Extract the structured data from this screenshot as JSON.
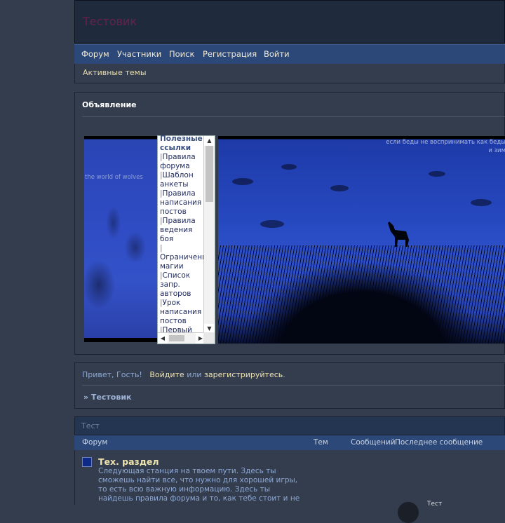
{
  "site": {
    "title": "Тестовик"
  },
  "nav": {
    "items": [
      "Форум",
      "Участники",
      "Поиск",
      "Регистрация",
      "Войти"
    ]
  },
  "subnav": {
    "active_topics": "Активные темы"
  },
  "announcement": {
    "title": "Объявление",
    "left_caption": "the world of wolves",
    "quote_line1": "если беды не воспринимать как беды",
    "quote_line2": "и зим",
    "links_heading": "Полезные ссылки",
    "links": [
      "Правила форума",
      "Шаблон анкеты",
      "Правила написания постов",
      "Правила ведения боя",
      "Ограничения магии",
      "Список запр. авторов",
      "Урок написания постов",
      "Первый"
    ],
    "link_bar": "|"
  },
  "greeting": {
    "hello": "Привет, Гость!",
    "login": "Войдите",
    "or": "или",
    "register": "зарегистрируйтесь",
    "period": ".",
    "breadcrumb": "» Тестовик"
  },
  "category": {
    "title": "Тест",
    "columns": {
      "forum": "Форум",
      "topics": "Тем",
      "posts": "Сообщений",
      "last": "Последнее сообщение"
    },
    "forums": [
      {
        "name": "Тех. раздел",
        "description": "Следующая станция на твоем пути. Здесь ты сможешь найти все, что нужно для хорошей игры, то есть всю важную информацию. Здесь ты найдешь правила форума и то, как тебе стоит и не",
        "last_post": "Тест"
      }
    ]
  },
  "colors": {
    "nav_bg": "#2c4878",
    "link": "#f0e4b0",
    "page_bg": "#333d4d"
  }
}
